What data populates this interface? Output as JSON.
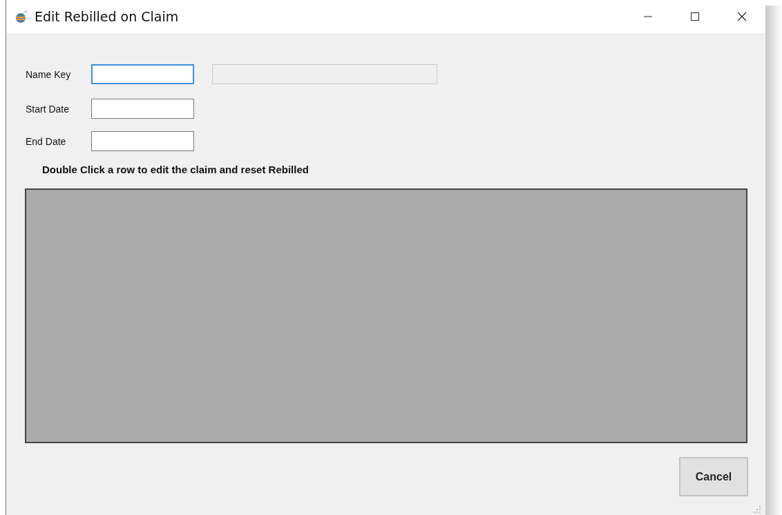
{
  "window": {
    "title": "Edit Rebilled on Claim"
  },
  "fields": [
    {
      "label": "Name Key",
      "focused": true,
      "disabled": false,
      "kind": "pair"
    },
    {
      "label": "Start Date",
      "focused": false,
      "disabled": false,
      "kind": "single"
    },
    {
      "label": "End Date",
      "focused": false,
      "disabled": false,
      "kind": "single"
    }
  ],
  "side_field": {
    "disabled": true
  },
  "instruction": "Double Click a row to edit the claim and reset Rebilled",
  "buttons": [
    {
      "label": "Cancel"
    }
  ]
}
